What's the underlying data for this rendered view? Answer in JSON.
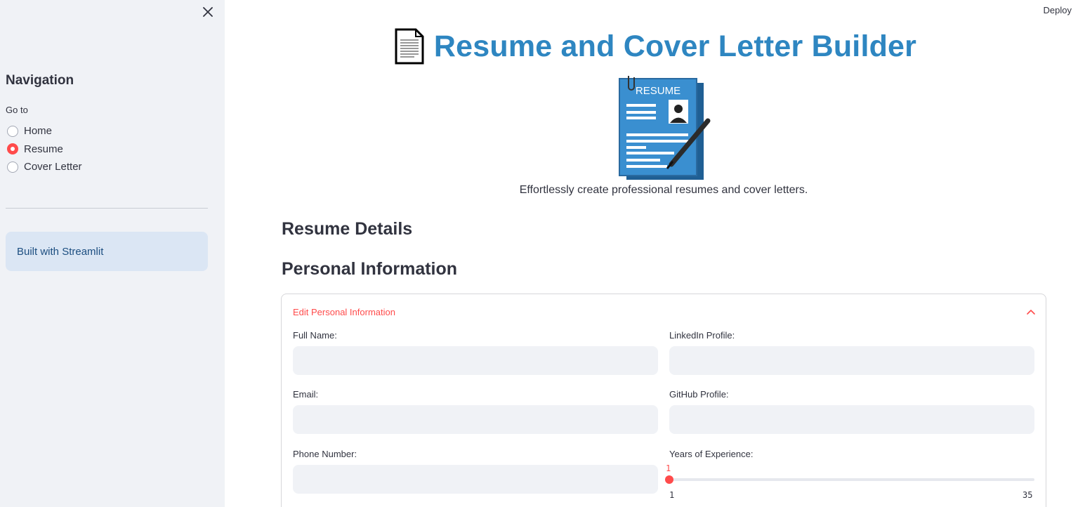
{
  "sidebar": {
    "close_icon": "close-icon",
    "heading": "Navigation",
    "goto_label": "Go to",
    "options": [
      {
        "label": "Home",
        "selected": false
      },
      {
        "label": "Resume",
        "selected": true
      },
      {
        "label": "Cover Letter",
        "selected": false
      }
    ],
    "info": "Built with Streamlit"
  },
  "header": {
    "deploy_label": "Deploy"
  },
  "main": {
    "title_icon": "document-icon",
    "title": "Resume and Cover Letter Builder",
    "hero_image_label": "RESUME",
    "tagline": "Effortlessly create professional resumes and cover letters.",
    "section_heading": "Resume Details",
    "subsection_heading": "Personal Information",
    "expander": {
      "title": "Edit Personal Information",
      "chevron_icon": "chevron-up-icon",
      "fields": {
        "full_name": {
          "label": "Full Name:",
          "value": ""
        },
        "linkedin": {
          "label": "LinkedIn Profile:",
          "value": ""
        },
        "email": {
          "label": "Email:",
          "value": ""
        },
        "github": {
          "label": "GitHub Profile:",
          "value": ""
        },
        "phone": {
          "label": "Phone Number:",
          "value": ""
        }
      },
      "experience_slider": {
        "label": "Years of Experience:",
        "value": "1",
        "min": "1",
        "max": "35"
      }
    }
  },
  "colors": {
    "accent": "#ff4b4b",
    "title": "#2e86c1",
    "sidebar_bg": "#f0f2f6",
    "info_bg": "#dbe6f4",
    "info_text": "#1c4e80"
  }
}
